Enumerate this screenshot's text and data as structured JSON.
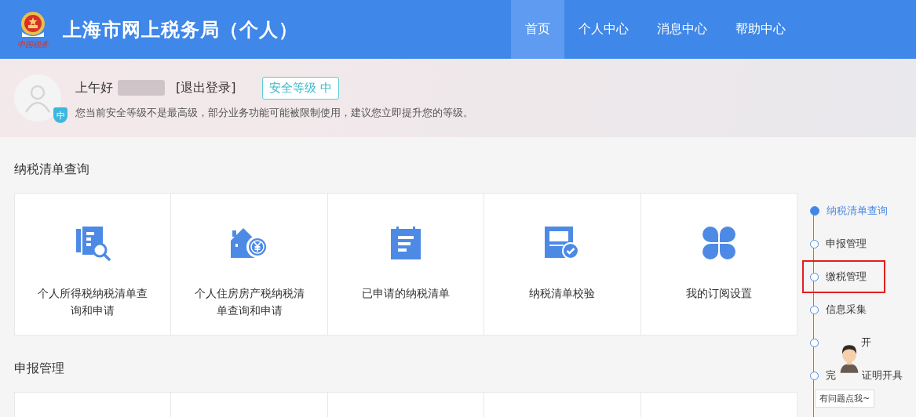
{
  "header": {
    "title": "上海市网上税务局（个人）",
    "emblem_caption": "中国税务",
    "nav": [
      {
        "label": "首页",
        "selected": true
      },
      {
        "label": "个人中心",
        "selected": false
      },
      {
        "label": "消息中心",
        "selected": false
      },
      {
        "label": "帮助中心",
        "selected": false
      }
    ]
  },
  "user": {
    "greeting": "上午好",
    "name_redacted": true,
    "logout": "[退出登录]",
    "security_badge": "安全等级 中",
    "avatar_badge": "中",
    "notice": "您当前安全等级不是最高级，部分业务功能可能被限制使用，建议您立即提升您的等级。"
  },
  "sections": [
    {
      "title": "纳税清单查询",
      "cards": [
        {
          "kind": "tile",
          "label": "个人所得税纳税清单查询和申请"
        },
        {
          "kind": "tile",
          "label": "个人住房房产税纳税清单查询和申请"
        },
        {
          "kind": "tile",
          "label": "已申请的纳税清单"
        },
        {
          "kind": "tile",
          "label": "纳税清单校验"
        },
        {
          "kind": "tile",
          "label": "我的订阅设置"
        }
      ]
    },
    {
      "title": "申报管理"
    }
  ],
  "side_nav": [
    {
      "kind": "plain",
      "parts": [
        "纳税清单查询"
      ],
      "selected": true,
      "highlighted": false
    },
    {
      "kind": "plain",
      "parts": [
        "申报管理"
      ],
      "selected": false,
      "highlighted": false
    },
    {
      "kind": "plain",
      "parts": [
        "缴税管理"
      ],
      "selected": false,
      "highlighted": true
    },
    {
      "kind": "plain",
      "parts": [
        "信息采集"
      ],
      "selected": false,
      "highlighted": false
    },
    {
      "kind": "covered",
      "parts": [
        "开"
      ],
      "selected": false,
      "highlighted": false
    },
    {
      "kind": "plain",
      "parts": [
        "完",
        "证明开具"
      ],
      "selected": false,
      "highlighted": false
    }
  ],
  "helper": {
    "tooltip": "有问题点我~"
  }
}
